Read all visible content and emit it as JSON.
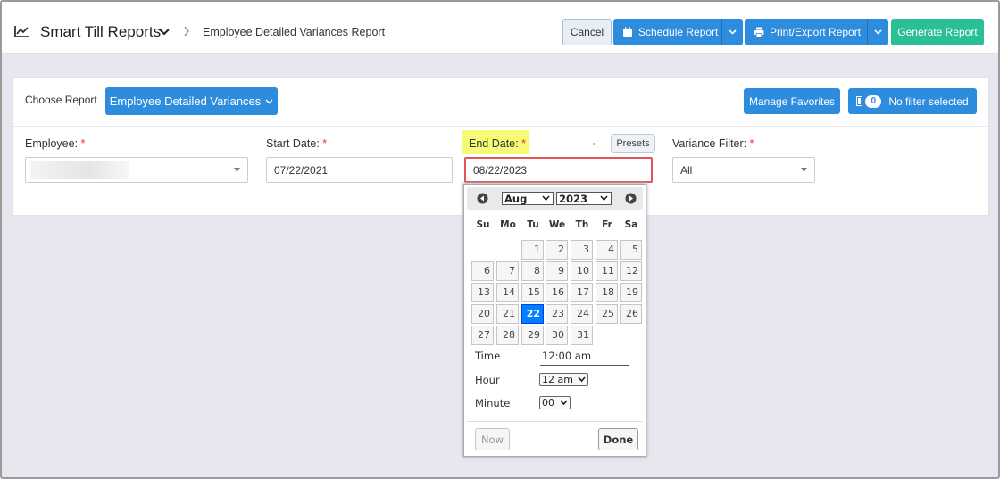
{
  "header": {
    "app_title": "Smart Till Reports",
    "breadcrumb": "Employee Detailed Variances Report",
    "cancel_label": "Cancel",
    "schedule_label": "Schedule Report",
    "print_label": "Print/Export Report",
    "generate_label": "Generate Report",
    "icons": [
      "chart-line-icon",
      "chevron-down-icon",
      "chevron-right-icon",
      "calendar-icon",
      "printer-icon"
    ]
  },
  "report_bar": {
    "choose_label": "Choose Report",
    "report_button": "Employee Detailed Variances",
    "favorites_button": "Manage Favorites",
    "filter_count": "0",
    "filter_status": "No filter selected"
  },
  "form": {
    "employee_label": "Employee:",
    "start_label": "Start Date:",
    "start_value": "07/22/2021",
    "end_label": "End Date:",
    "end_value": "08/22/2023",
    "presets_label": "Presets",
    "variance_label": "Variance Filter:",
    "variance_value": "All",
    "required_mark": "*"
  },
  "datepicker": {
    "month": "Aug",
    "year": "2023",
    "weekdays": [
      "Su",
      "Mo",
      "Tu",
      "We",
      "Th",
      "Fr",
      "Sa"
    ],
    "days": [
      "1",
      "2",
      "3",
      "4",
      "5",
      "6",
      "7",
      "8",
      "9",
      "10",
      "11",
      "12",
      "13",
      "14",
      "15",
      "16",
      "17",
      "18",
      "19",
      "20",
      "21",
      "22",
      "23",
      "24",
      "25",
      "26",
      "27",
      "28",
      "29",
      "30",
      "31"
    ],
    "selected_day": "22",
    "time_label": "Time",
    "time_value": "12:00 am",
    "hour_label": "Hour",
    "hour_value": "12 am",
    "minute_label": "Minute",
    "minute_value": "00",
    "now_label": "Now",
    "done_label": "Done"
  },
  "colors": {
    "primary": "#2d8cde",
    "success": "#2bbf97",
    "required": "#e33333",
    "highlight": "#f7fa77",
    "selected_day": "#007fff"
  }
}
